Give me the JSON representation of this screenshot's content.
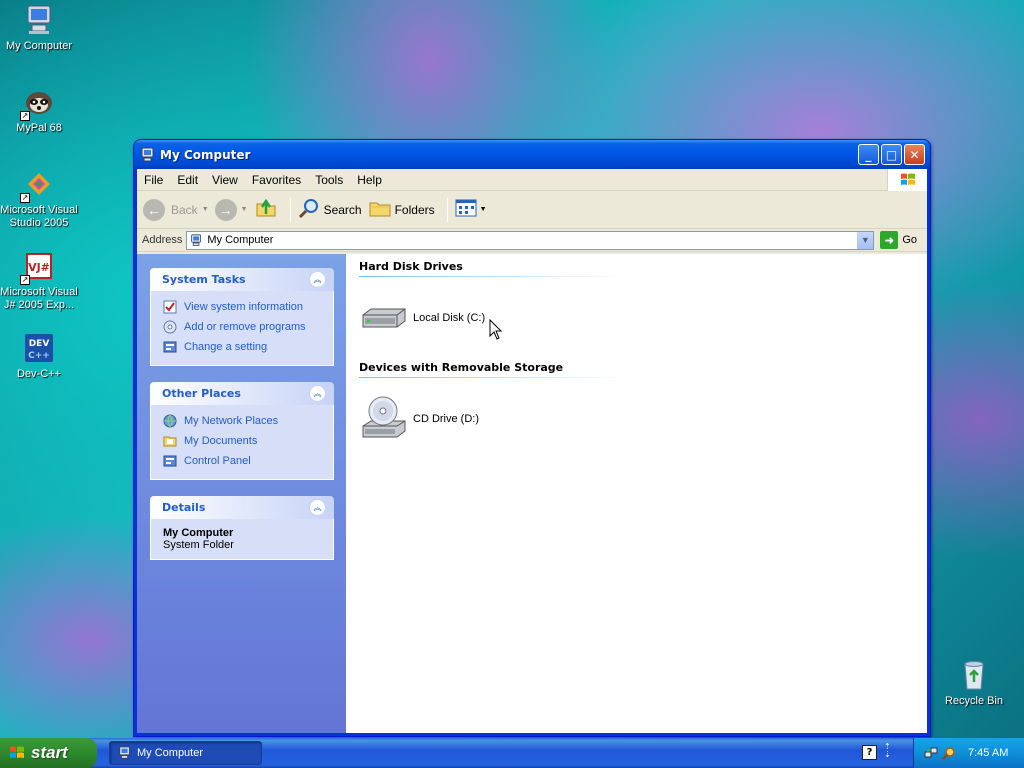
{
  "desktop": {
    "icons": [
      {
        "label": "My Computer"
      },
      {
        "label": "MyPal 68"
      },
      {
        "label": "Microsoft Visual Studio 2005"
      },
      {
        "label": "Microsoft Visual J# 2005 Exp..."
      },
      {
        "label": "Dev-C++"
      },
      {
        "label": "Recycle Bin"
      }
    ]
  },
  "window": {
    "title": "My Computer",
    "menu": [
      "File",
      "Edit",
      "View",
      "Favorites",
      "Tools",
      "Help"
    ],
    "toolbar": {
      "back_label": "Back",
      "search_label": "Search",
      "folders_label": "Folders"
    },
    "address": {
      "label": "Address",
      "value": "My Computer",
      "go_label": "Go"
    },
    "taskpane": {
      "system_tasks": {
        "title": "System Tasks",
        "items": [
          "View system information",
          "Add or remove programs",
          "Change a setting"
        ]
      },
      "other_places": {
        "title": "Other Places",
        "items": [
          "My Network Places",
          "My Documents",
          "Control Panel"
        ]
      },
      "details": {
        "title": "Details",
        "name": "My Computer",
        "type": "System Folder"
      }
    },
    "groups": [
      {
        "title": "Hard Disk Drives",
        "items": [
          {
            "label": "Local Disk (C:)",
            "icon": "hard-disk-icon"
          }
        ]
      },
      {
        "title": "Devices with Removable Storage",
        "items": [
          {
            "label": "CD Drive (D:)",
            "icon": "cd-drive-icon"
          }
        ]
      }
    ]
  },
  "taskbar": {
    "start_label": "start",
    "task_button_label": "My Computer",
    "clock": "7:45 AM"
  },
  "colors": {
    "title_blue": "#0055e5",
    "link_blue": "#215dc6",
    "start_green": "#2d8a2d"
  }
}
